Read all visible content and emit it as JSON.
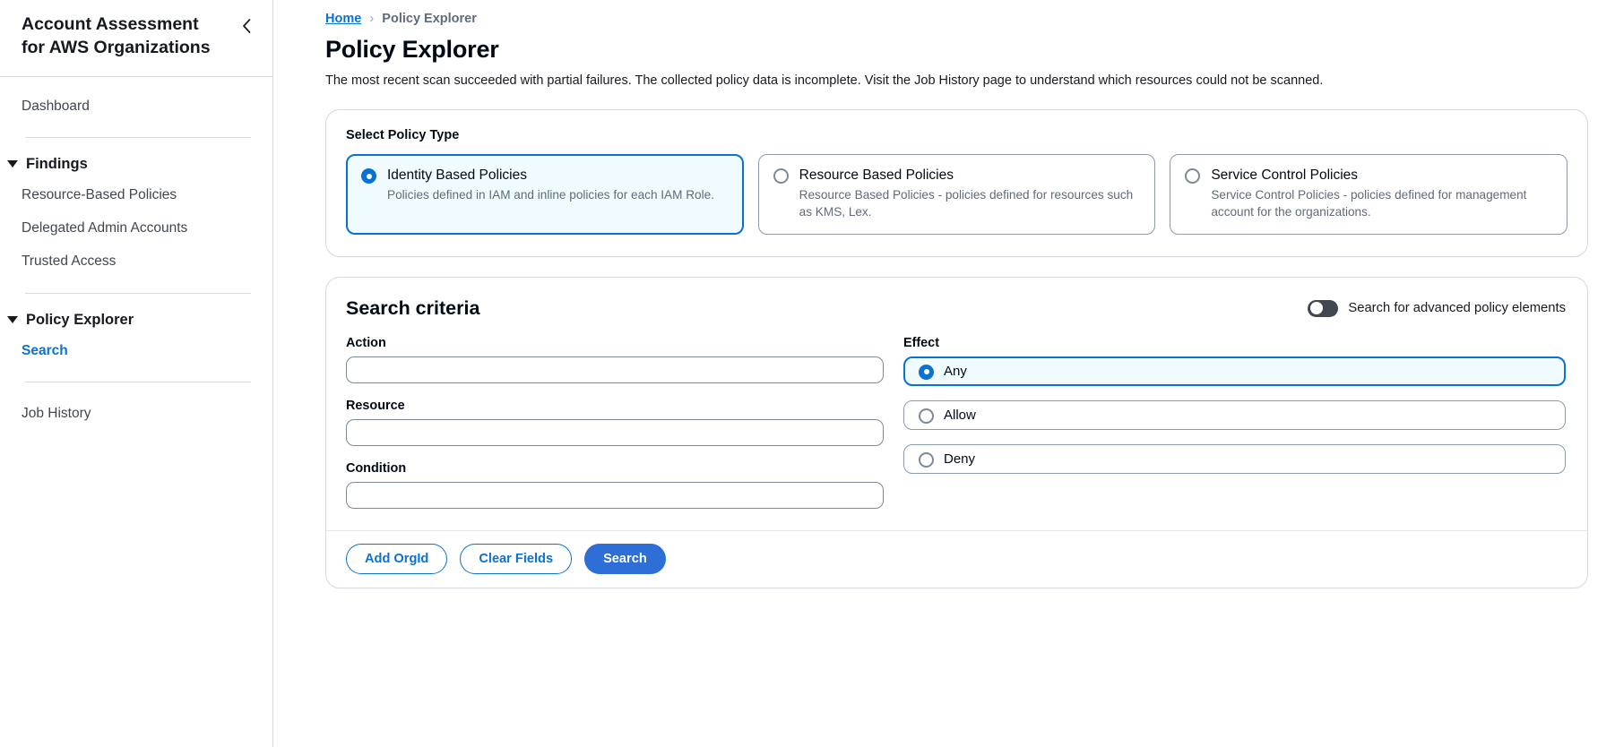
{
  "sidebar": {
    "title": "Account Assessment for AWS Organizations",
    "collapse_icon": "chevron-left-icon",
    "dashboard": "Dashboard",
    "groups": [
      {
        "title": "Findings",
        "caret_icon": "caret-down-icon",
        "items": [
          {
            "label": "Resource-Based Policies",
            "active": false
          },
          {
            "label": "Delegated Admin Accounts",
            "active": false
          },
          {
            "label": "Trusted Access",
            "active": false
          }
        ]
      },
      {
        "title": "Policy Explorer",
        "caret_icon": "caret-down-icon",
        "items": [
          {
            "label": "Search",
            "active": true
          }
        ]
      }
    ],
    "job_history": "Job History"
  },
  "breadcrumb": {
    "home": "Home",
    "separator": "›",
    "current": "Policy Explorer"
  },
  "header": {
    "title": "Policy Explorer",
    "description": "The most recent scan succeeded with partial failures. The collected policy data is incomplete. Visit the Job History page to understand which resources could not be scanned."
  },
  "policy_type": {
    "label": "Select Policy Type",
    "options": [
      {
        "title": "Identity Based Policies",
        "description": "Policies defined in IAM and inline policies for each IAM Role.",
        "selected": true
      },
      {
        "title": "Resource Based Policies",
        "description": "Resource Based Policies - policies defined for resources such as KMS, Lex.",
        "selected": false
      },
      {
        "title": "Service Control Policies",
        "description": "Service Control Policies - policies defined for management account for the organizations.",
        "selected": false
      }
    ]
  },
  "search_criteria": {
    "title": "Search criteria",
    "advanced_toggle_label": "Search for advanced policy elements",
    "advanced_toggle_on": false,
    "fields": [
      {
        "label": "Action",
        "value": "",
        "placeholder": ""
      },
      {
        "label": "Resource",
        "value": "",
        "placeholder": ""
      },
      {
        "label": "Condition",
        "value": "",
        "placeholder": ""
      }
    ],
    "effect": {
      "label": "Effect",
      "options": [
        {
          "label": "Any",
          "selected": true
        },
        {
          "label": "Allow",
          "selected": false
        },
        {
          "label": "Deny",
          "selected": false
        }
      ]
    },
    "buttons": {
      "add_orgid": "Add OrgId",
      "clear_fields": "Clear Fields",
      "search": "Search"
    }
  },
  "colors": {
    "accent": "#0972d3",
    "primary_button": "#2d6fd6",
    "selected_bg": "#f0fbff",
    "border": "#8c9bab"
  }
}
